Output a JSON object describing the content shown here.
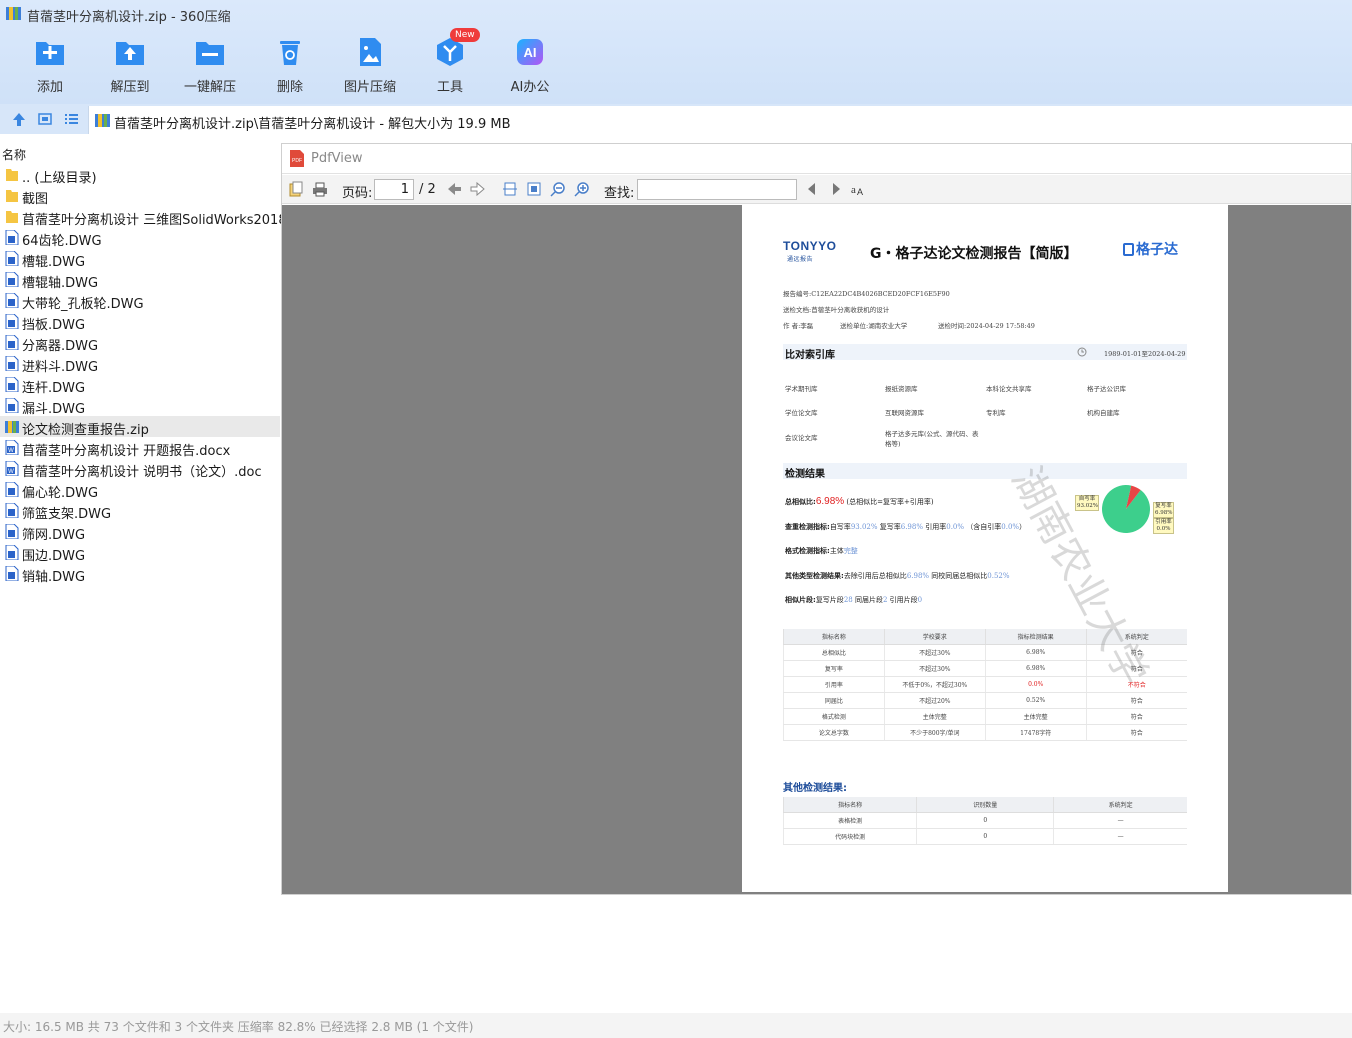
{
  "window": {
    "title": "苜蓿茎叶分离机设计.zip - 360压缩"
  },
  "toolbar": {
    "items": [
      {
        "label": "添加",
        "icon": "add-icon"
      },
      {
        "label": "解压到",
        "icon": "extract-to-icon"
      },
      {
        "label": "一键解压",
        "icon": "one-click-extract-icon"
      },
      {
        "label": "删除",
        "icon": "delete-icon"
      },
      {
        "label": "图片压缩",
        "icon": "image-compress-icon"
      },
      {
        "label": "工具",
        "icon": "tools-icon",
        "badge": "New"
      },
      {
        "label": "AI办公",
        "icon": "ai-office-icon"
      }
    ]
  },
  "addressbar": {
    "path": "苜蓿茎叶分离机设计.zip\\苜蓿茎叶分离机设计 - 解包大小为 19.9 MB"
  },
  "filelist": {
    "column_name": "名称",
    "items": [
      {
        "name": ".. (上级目录)",
        "type": "folder"
      },
      {
        "name": "截图",
        "type": "folder"
      },
      {
        "name": "苜蓿茎叶分离机设计 三维图SolidWorks2018",
        "type": "folder"
      },
      {
        "name": "64齿轮.DWG",
        "type": "dwg"
      },
      {
        "name": "槽辊.DWG",
        "type": "dwg"
      },
      {
        "name": "槽辊轴.DWG",
        "type": "dwg"
      },
      {
        "name": "大带轮_孔板轮.DWG",
        "type": "dwg"
      },
      {
        "name": "挡板.DWG",
        "type": "dwg"
      },
      {
        "name": "分离器.DWG",
        "type": "dwg"
      },
      {
        "name": "进料斗.DWG",
        "type": "dwg"
      },
      {
        "name": "连杆.DWG",
        "type": "dwg"
      },
      {
        "name": "漏斗.DWG",
        "type": "dwg"
      },
      {
        "name": "论文检测查重报告.zip",
        "type": "zip",
        "selected": true
      },
      {
        "name": "苜蓿茎叶分离机设计 开题报告.docx",
        "type": "word"
      },
      {
        "name": "苜蓿茎叶分离机设计 说明书（论文）.doc",
        "type": "word"
      },
      {
        "name": "偏心轮.DWG",
        "type": "dwg"
      },
      {
        "name": "筛篮支架.DWG",
        "type": "dwg"
      },
      {
        "name": "筛网.DWG",
        "type": "dwg"
      },
      {
        "name": "围边.DWG",
        "type": "dwg"
      },
      {
        "name": "销轴.DWG",
        "type": "dwg"
      }
    ]
  },
  "pdfview": {
    "title": "PdfView",
    "page_label": "页码:",
    "page_current": "1",
    "page_total": "/ 2",
    "find_label": "查找:",
    "find_value": ""
  },
  "report": {
    "logo_left": "TONYYO",
    "logo_left_sub": "通远报告",
    "title": "G・格子达论文检测报告【简版】",
    "logo_right": "格子达",
    "meta_number": "报告编号:C12EA22DC4B4026BCED20FCF16E5F90",
    "meta_doc": "送检文档:苜蓿茎叶分离收获机的设计",
    "meta_author": "作 者:李磊",
    "meta_unit": "送检单位:湖南农业大学",
    "meta_time": "送检时间:2024-04-29 17:58:49",
    "section_compare": "比对索引库",
    "date_range": "1989-01-01至2024-04-29",
    "databases": [
      "学术期刊库",
      "报纸资源库",
      "本科论文共享库",
      "格子达公识库",
      "学位论文库",
      "互联网资源库",
      "专利库",
      "机构自建库",
      "会议论文库",
      "格子达多元库(公式、源代码、表格等)"
    ],
    "section_result": "检测结果",
    "total_label": "总相似比:",
    "total_value": "6.98%",
    "total_note": "(总相似比=复写率+引用率)",
    "check_label": "查重检测指标:",
    "check_text_1": "自写率",
    "check_val_1": "93.02%",
    "check_text_2": " 复写率",
    "check_val_2": "6.98%",
    "check_text_3": " 引用率",
    "check_val_3": "0.0%",
    "check_text_4": " （含自引率",
    "check_val_4": "0.0%",
    "check_text_5": "）",
    "format_label": "格式检测指标:",
    "format_text": "主体",
    "format_val": "完整",
    "other_label": "其他类型检测结果:",
    "other_text_1": "去除引用后总相似比",
    "other_val_1": "6.98%",
    "other_text_2": " 同校同届总相似比",
    "other_val_2": "0.52%",
    "seg_label": "相似片段:",
    "seg_text_1": "复写片段",
    "seg_val_1": "28",
    "seg_text_2": " 同届片段",
    "seg_val_2": "2",
    "seg_text_3": " 引用片段",
    "seg_val_3": "0",
    "pie_self": "自写率 93.02%",
    "pie_copy": "复写率 6.98%",
    "pie_cite": "引用率 0.0%",
    "pie_data": {
      "self": 93.02,
      "copy": 6.98,
      "cite": 0.0
    },
    "table_headers": [
      "指标名称",
      "学校要求",
      "指标检测结果",
      "系统判定"
    ],
    "table_rows": [
      [
        "总相似比",
        "不超过30%",
        "6.98%",
        "符合"
      ],
      [
        "复写率",
        "不超过30%",
        "6.98%",
        "符合"
      ],
      [
        "引用率",
        "不低于0%，不超过30%",
        "0.0%",
        "不符合"
      ],
      [
        "同届比",
        "不超过20%",
        "0.52%",
        "符合"
      ],
      [
        "格式检测",
        "主体完整",
        "主体完整",
        "符合"
      ],
      [
        "论文总字数",
        "不少于800字/单词",
        "17478字符",
        "符合"
      ]
    ],
    "other_section": "其他检测结果:",
    "other_headers": [
      "指标名称",
      "识别数量",
      "系统判定"
    ],
    "other_rows": [
      [
        "表格检测",
        "0",
        "—"
      ],
      [
        "代码块检测",
        "0",
        "—"
      ]
    ],
    "watermark": "湖南农业大学"
  },
  "statusbar": {
    "text": "大小: 16.5 MB 共 73 个文件和 3 个文件夹 压缩率 82.8% 已经选择 2.8 MB (1 个文件)"
  },
  "colors": {
    "accent": "#1e7ae6",
    "toolbar_bg": "#d4e5f9",
    "red": "#e02020",
    "pie_green": "#3dcf8c",
    "pie_red": "#e84545"
  }
}
